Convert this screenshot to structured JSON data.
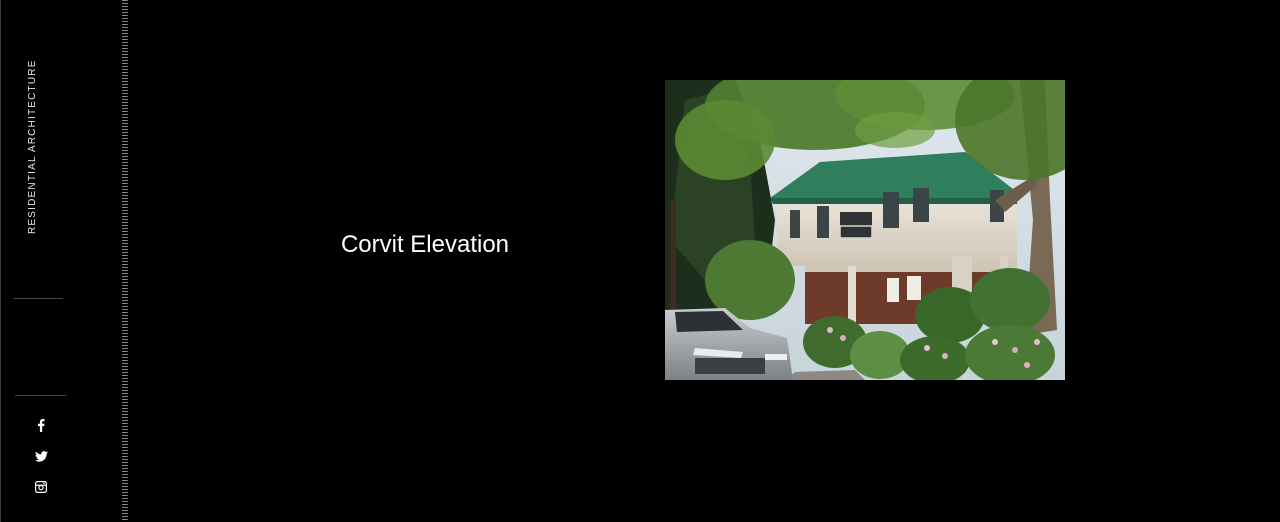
{
  "sidebar": {
    "vertical_title": "RESIDENTIAL ARCHITECTURE",
    "social": [
      {
        "icon": "facebook-icon"
      },
      {
        "icon": "twitter-icon"
      },
      {
        "icon": "instagram-icon"
      }
    ]
  },
  "main": {
    "project_title": "Corvit Elevation",
    "image": {
      "subject": "two-storey house with green roof, trees, hedges and a silver car"
    }
  },
  "colors": {
    "background": "#000000",
    "text": "#ffffff",
    "divider": "#444444"
  }
}
